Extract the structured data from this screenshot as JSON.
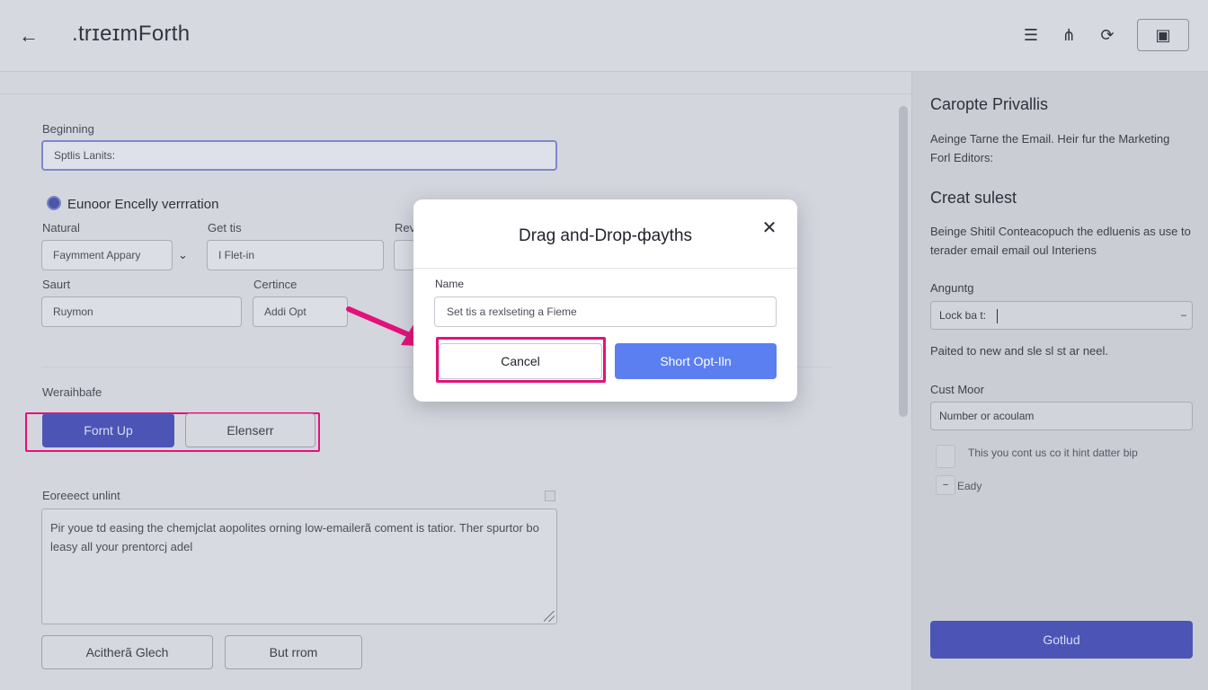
{
  "header": {
    "back_icon": "arrow-left-icon",
    "title": ".trɪeɪmForth",
    "icons": [
      "list-icon",
      "flowchart-icon",
      "refresh-icon",
      "save-icon"
    ]
  },
  "form": {
    "beginning_label": "Beginning",
    "beginning_value": "Sptlis Lanits:",
    "section_title": "Eunoor Encelly verrration",
    "natural_label": "Natural",
    "natural_value": "Faymment Appary",
    "getting_label": "Get tis",
    "getting_value": "I Flet-in",
    "rev_label": "Rev",
    "start_label": "Saurt",
    "start_value": "Ruymon",
    "certince_label": "Certince",
    "certince_value": "Addi Opt",
    "variable_label": "Weraihbafe",
    "primary_button": "Fornt Up",
    "secondary_button": "Elenserr",
    "excerpt_label": "Eoreeect unlint",
    "excerpt_text": "Pir youe td easing the chemjclat aopolites orning low-emailerã coment is tatior. Ther spurtor bo leasy all your prentorcj adel",
    "bottom_left_button": "Acitherã Glech",
    "bottom_right_button": "But rrom"
  },
  "side": {
    "title": "Caropte Privallis",
    "description": "Aeinge Tarne the Email. Heir fur the Marketing Forl Editors:",
    "subtitle": "Creat sulest",
    "subtitle_text": "Beinge Shitil Conteacopuch the edluenis as use to terader email email oul Interiens",
    "field1_label": "Anguntg",
    "field1_value": "Lock ba t:",
    "info_text": "Paited to new and sle sl st ar neel.",
    "field2_label": "Cust Moor",
    "field2_value": "Number or acoulam",
    "check1_label": "This you cont us co it hint datter bip",
    "check2_label": "Eady",
    "action_button": "Gotlud"
  },
  "modal": {
    "title": "Drag and-Drop-фayths",
    "close_icon": "close-icon",
    "name_label": "Name",
    "name_placeholder": "Set tis a rexlseting a Fieme",
    "cancel_label": "Cancel",
    "primary_label": "Short Opt-Iln"
  },
  "colors": {
    "accent": "#4c55b6",
    "modal_primary": "#5b7ff0",
    "highlight": "#e3127a"
  }
}
